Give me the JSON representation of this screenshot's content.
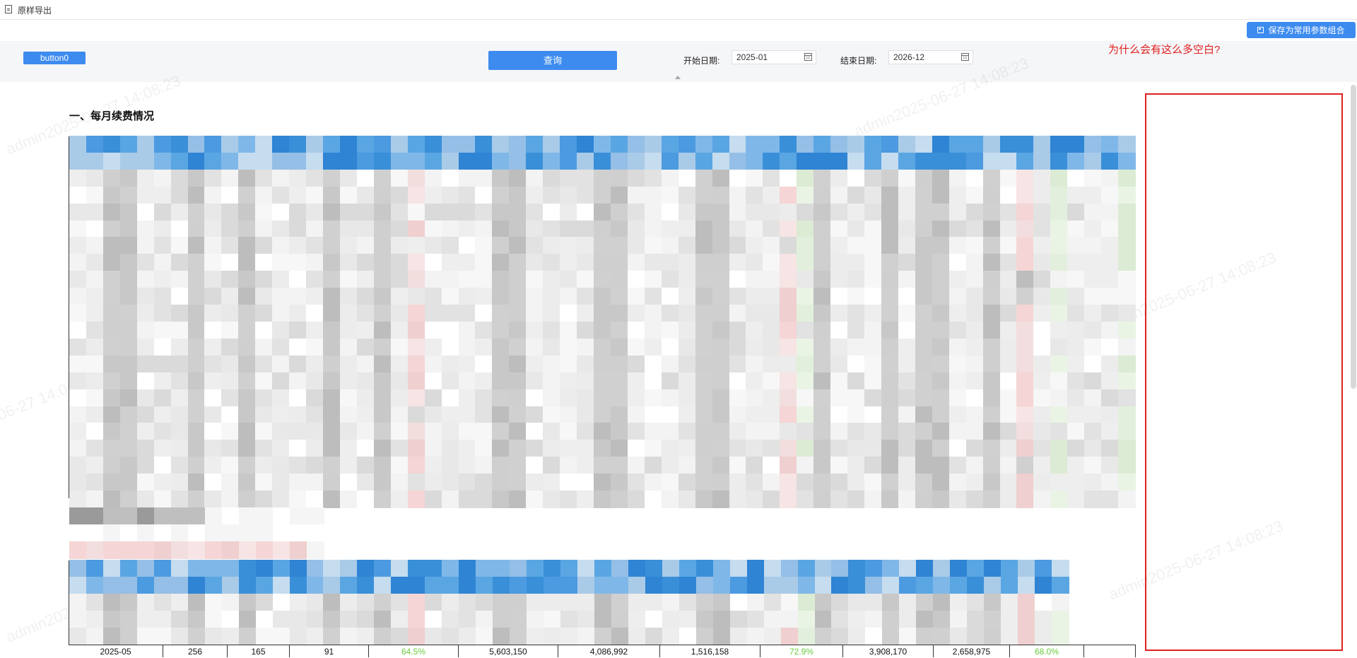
{
  "window": {
    "title": "原样导出"
  },
  "toolbar": {
    "save_label": "保存为常用参数组合"
  },
  "query": {
    "button0_label": "button0",
    "query_label": "查询",
    "start_label": "开始日期:",
    "start_value": "2025-01",
    "end_label": "结束日期:",
    "end_value": "2026-12"
  },
  "annotation": {
    "text": "为什么会有这么多空白?"
  },
  "report": {
    "section_title": "一、每月续费情况",
    "watermark": "admin2025-06-27 14:08:23",
    "footer_row": [
      "2025-05",
      "256",
      "165",
      "91",
      "64.5%",
      "5,603,150",
      "4,086,992",
      "1,516,158",
      "72.9%",
      "3,908,170",
      "2,658,975",
      "68.0%",
      ""
    ]
  },
  "colors": {
    "accent": "#3d8bef",
    "annotation": "#e02020",
    "percent": "#6ccb3e"
  }
}
